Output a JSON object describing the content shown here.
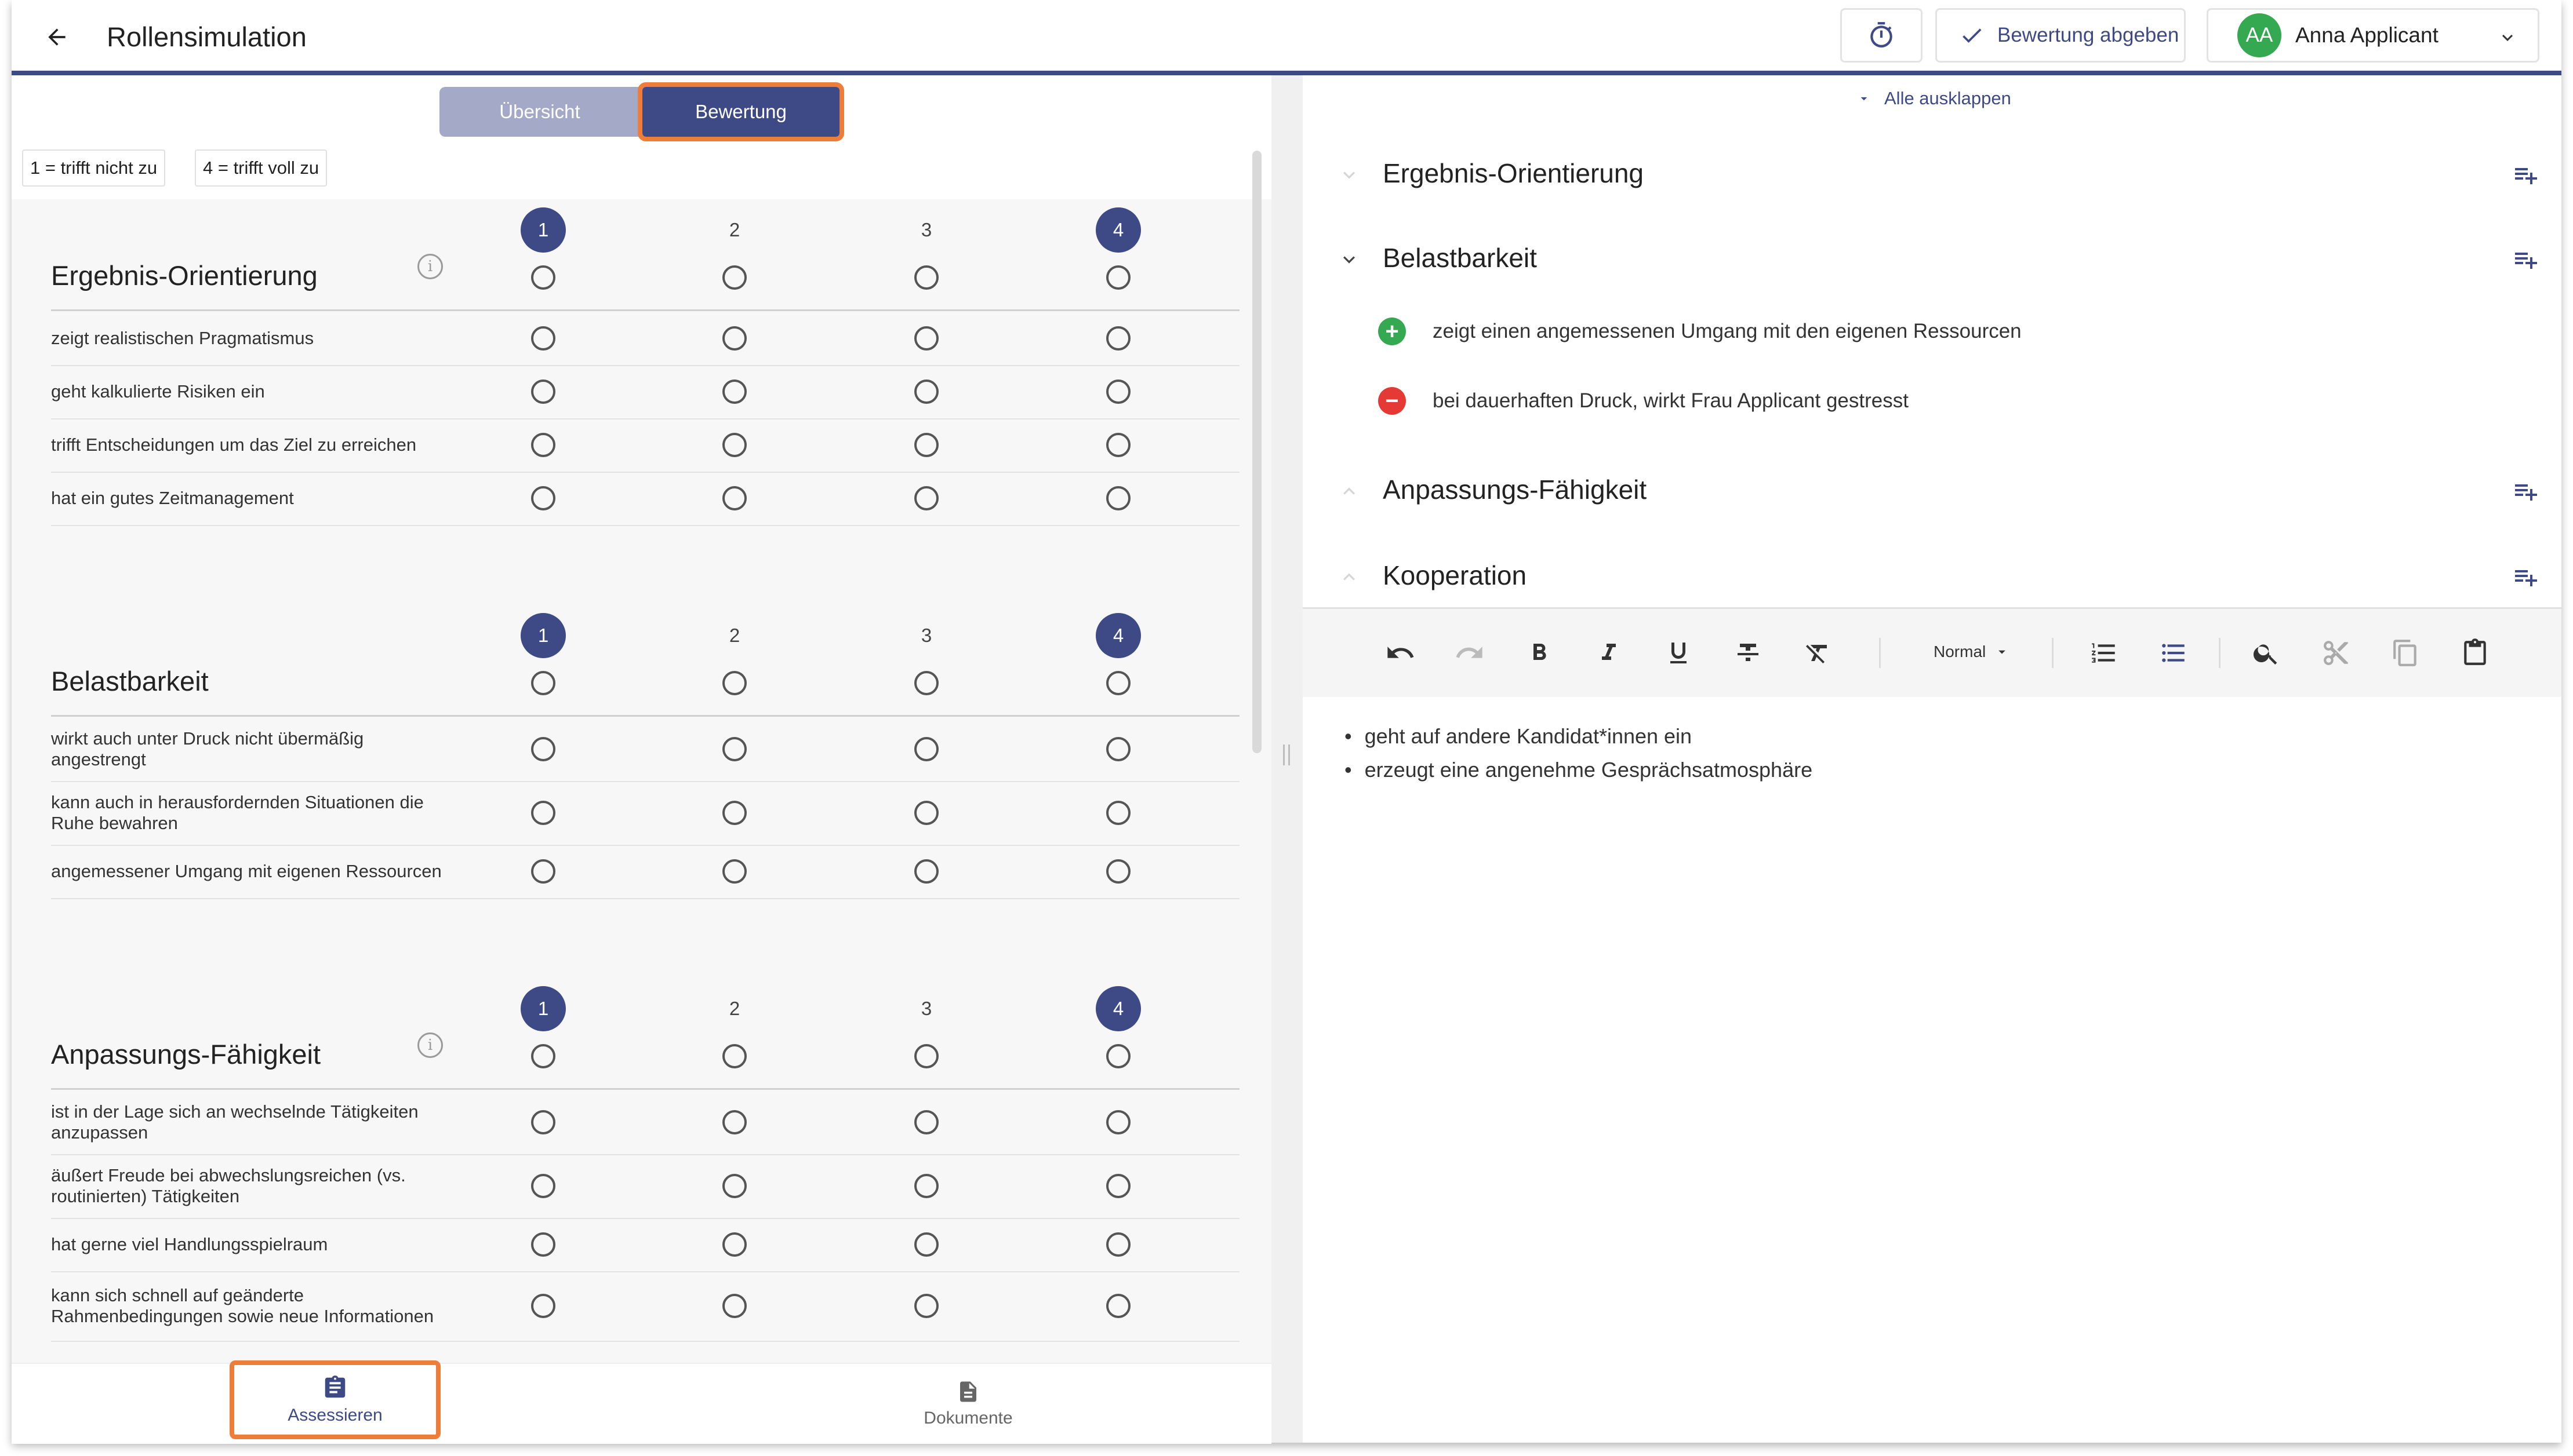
{
  "header": {
    "title": "Rollensimulation",
    "submit_label": "Bewertung abgeben",
    "user_initials": "AA",
    "user_name": "Anna Applicant"
  },
  "left": {
    "tabs": [
      "Übersicht",
      "Bewertung"
    ],
    "active_tab": "Bewertung",
    "legend": [
      "1 = trifft nicht zu",
      "4 = trifft voll zu"
    ],
    "scale": [
      "1",
      "2",
      "3",
      "4"
    ],
    "sections": [
      {
        "title": "Ergebnis-Orientierung",
        "info": "i",
        "items": [
          "zeigt realistischen Pragmatismus",
          "geht kalkulierte Risiken ein",
          "trifft Entscheidungen um das Ziel zu erreichen",
          "hat ein gutes Zeitmanagement"
        ]
      },
      {
        "title": "Belastbarkeit",
        "items": [
          "wirkt auch unter Druck nicht übermäßig angestrengt",
          "kann auch in herausfordernden Situationen die Ruhe bewahren",
          "angemessener Umgang mit eigenen Ressourcen"
        ]
      },
      {
        "title": "Anpassungs-Fähigkeit",
        "info": "i",
        "items": [
          "ist in der Lage sich an wechselnde Tätigkeiten anzupassen",
          "äußert Freude bei abwechslungsreichen (vs. routinierten) Tätigkeiten",
          "hat gerne viel Handlungsspielraum",
          "kann sich schnell auf geänderte Rahmenbedingungen sowie neue Informationen"
        ]
      }
    ],
    "bottom_nav": [
      "Assessieren",
      "Dokumente"
    ]
  },
  "right": {
    "expand_all": "Alle ausklappen",
    "categories": [
      {
        "label": "Ergebnis-Orientierung",
        "expanded": false
      },
      {
        "label": "Belastbarkeit",
        "expanded": true
      },
      {
        "label": "Anpassungs-Fähigkeit",
        "expanded": false
      },
      {
        "label": "Kooperation",
        "expanded": false
      }
    ],
    "notes": [
      {
        "type": "positive",
        "text": "zeigt einen angemessenen Umgang mit den eigenen Ressourcen",
        "symbol": "+"
      },
      {
        "type": "negative",
        "text": "bei dauerhaften Druck, wirkt Frau Applicant gestresst",
        "symbol": "−"
      }
    ],
    "format_select": "Normal",
    "editor_lines": [
      "geht auf andere Kandidat*innen ein",
      "erzeugt eine angenehme Gesprächsatmosphäre"
    ]
  },
  "colors": {
    "primary": "#3d4a86",
    "highlight": "#ef7d3a",
    "positive": "#35a852",
    "negative": "#e53935"
  }
}
